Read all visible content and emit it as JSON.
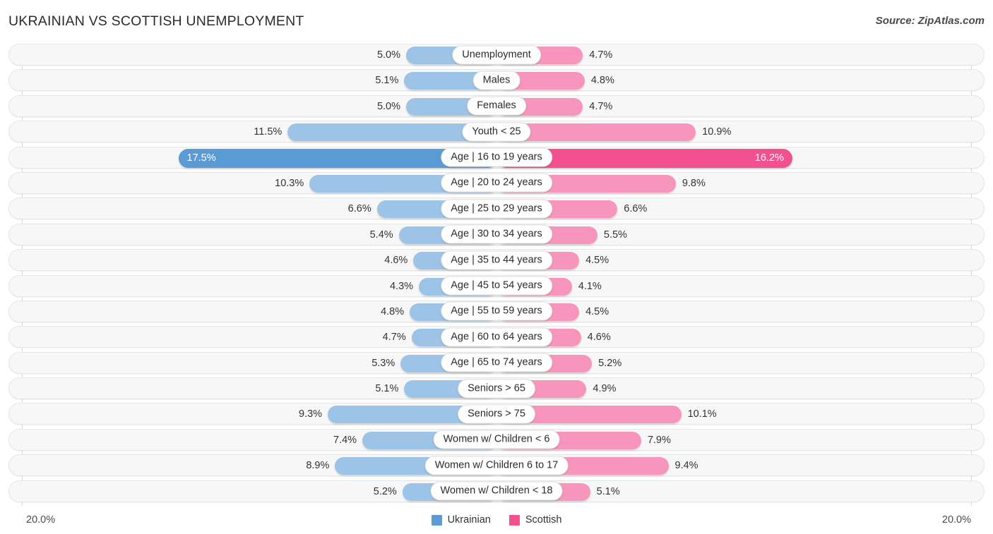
{
  "header": {
    "title": "UKRAINIAN VS SCOTTISH UNEMPLOYMENT",
    "source": "Source: ZipAtlas.com"
  },
  "legend": {
    "items": [
      {
        "label": "Ukrainian",
        "color": "#5b9bd5",
        "swatch": "ukr"
      },
      {
        "label": "Scottish",
        "color": "#f2508e",
        "swatch": "sco"
      }
    ]
  },
  "axis": {
    "left_max_label": "20.0%",
    "right_max_label": "20.0%"
  },
  "chart_data": {
    "type": "bar",
    "orientation": "horizontal-diverging",
    "title": "UKRAINIAN VS SCOTTISH UNEMPLOYMENT",
    "xlabel": "",
    "ylabel": "",
    "xlim": [
      20.0,
      20.0
    ],
    "grid": true,
    "legend_position": "bottom-center",
    "categories": [
      "Unemployment",
      "Males",
      "Females",
      "Youth < 25",
      "Age | 16 to 19 years",
      "Age | 20 to 24 years",
      "Age | 25 to 29 years",
      "Age | 30 to 34 years",
      "Age | 35 to 44 years",
      "Age | 45 to 54 years",
      "Age | 55 to 59 years",
      "Age | 60 to 64 years",
      "Age | 65 to 74 years",
      "Seniors > 65",
      "Seniors > 75",
      "Women w/ Children < 6",
      "Women w/ Children 6 to 17",
      "Women w/ Children < 18"
    ],
    "series": [
      {
        "name": "Ukrainian",
        "color": "#5b9bd5",
        "values": [
          5.0,
          5.1,
          5.0,
          11.5,
          17.5,
          10.3,
          6.6,
          5.4,
          4.6,
          4.3,
          4.8,
          4.7,
          5.3,
          5.1,
          9.3,
          7.4,
          8.9,
          5.2
        ],
        "labels": [
          "5.0%",
          "5.1%",
          "5.0%",
          "11.5%",
          "17.5%",
          "10.3%",
          "6.6%",
          "5.4%",
          "4.6%",
          "4.3%",
          "4.8%",
          "4.7%",
          "5.3%",
          "5.1%",
          "9.3%",
          "7.4%",
          "8.9%",
          "5.2%"
        ]
      },
      {
        "name": "Scottish",
        "color": "#f2508e",
        "values": [
          4.7,
          4.8,
          4.7,
          10.9,
          16.2,
          9.8,
          6.6,
          5.5,
          4.5,
          4.1,
          4.5,
          4.6,
          5.2,
          4.9,
          10.1,
          7.9,
          9.4,
          5.1
        ],
        "labels": [
          "4.7%",
          "4.8%",
          "4.7%",
          "10.9%",
          "16.2%",
          "9.8%",
          "6.6%",
          "5.5%",
          "4.5%",
          "4.1%",
          "4.5%",
          "4.6%",
          "5.2%",
          "4.9%",
          "10.1%",
          "7.9%",
          "9.4%",
          "5.1%"
        ]
      }
    ],
    "highlighted_row_index": 4
  }
}
